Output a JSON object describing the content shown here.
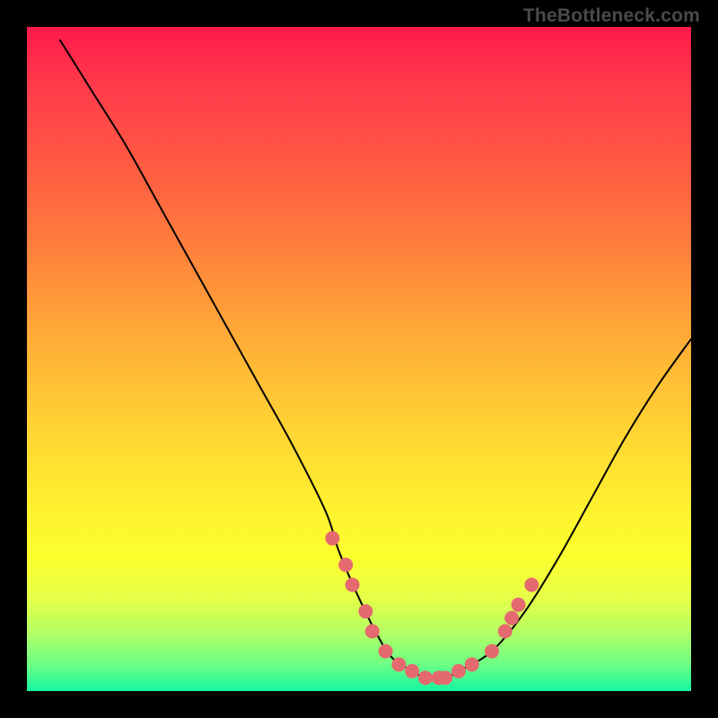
{
  "watermark": {
    "text": "TheBottleneck.com"
  },
  "chart_data": {
    "type": "line",
    "title": "",
    "xlabel": "",
    "ylabel": "",
    "xlim": [
      0,
      100
    ],
    "ylim": [
      0,
      100
    ],
    "series": [
      {
        "name": "bottleneck-curve",
        "x": [
          5,
          10,
          15,
          20,
          25,
          30,
          35,
          40,
          45,
          47,
          50,
          53,
          55,
          58,
          60,
          63,
          65,
          70,
          75,
          80,
          85,
          90,
          95,
          100
        ],
        "y": [
          98,
          90,
          82,
          73,
          64,
          55,
          46,
          37,
          27,
          21,
          14,
          8,
          5,
          3,
          2,
          2,
          3,
          6,
          12,
          20,
          29,
          38,
          46,
          53
        ]
      }
    ],
    "markers": {
      "name": "highlight-dots",
      "color": "#e56a6f",
      "radius_px": 8,
      "points": [
        {
          "x": 46,
          "y": 23
        },
        {
          "x": 48,
          "y": 19
        },
        {
          "x": 49,
          "y": 16
        },
        {
          "x": 51,
          "y": 12
        },
        {
          "x": 52,
          "y": 9
        },
        {
          "x": 54,
          "y": 6
        },
        {
          "x": 56,
          "y": 4
        },
        {
          "x": 58,
          "y": 3
        },
        {
          "x": 60,
          "y": 2
        },
        {
          "x": 62,
          "y": 2
        },
        {
          "x": 63,
          "y": 2
        },
        {
          "x": 65,
          "y": 3
        },
        {
          "x": 67,
          "y": 4
        },
        {
          "x": 70,
          "y": 6
        },
        {
          "x": 72,
          "y": 9
        },
        {
          "x": 73,
          "y": 11
        },
        {
          "x": 74,
          "y": 13
        },
        {
          "x": 76,
          "y": 16
        }
      ]
    },
    "background_gradient": {
      "orientation": "vertical",
      "stops": [
        {
          "pct": 0,
          "color": "#ff1a4a"
        },
        {
          "pct": 50,
          "color": "#ffb636"
        },
        {
          "pct": 80,
          "color": "#fcff2e"
        },
        {
          "pct": 100,
          "color": "#13f8a0"
        }
      ]
    }
  }
}
